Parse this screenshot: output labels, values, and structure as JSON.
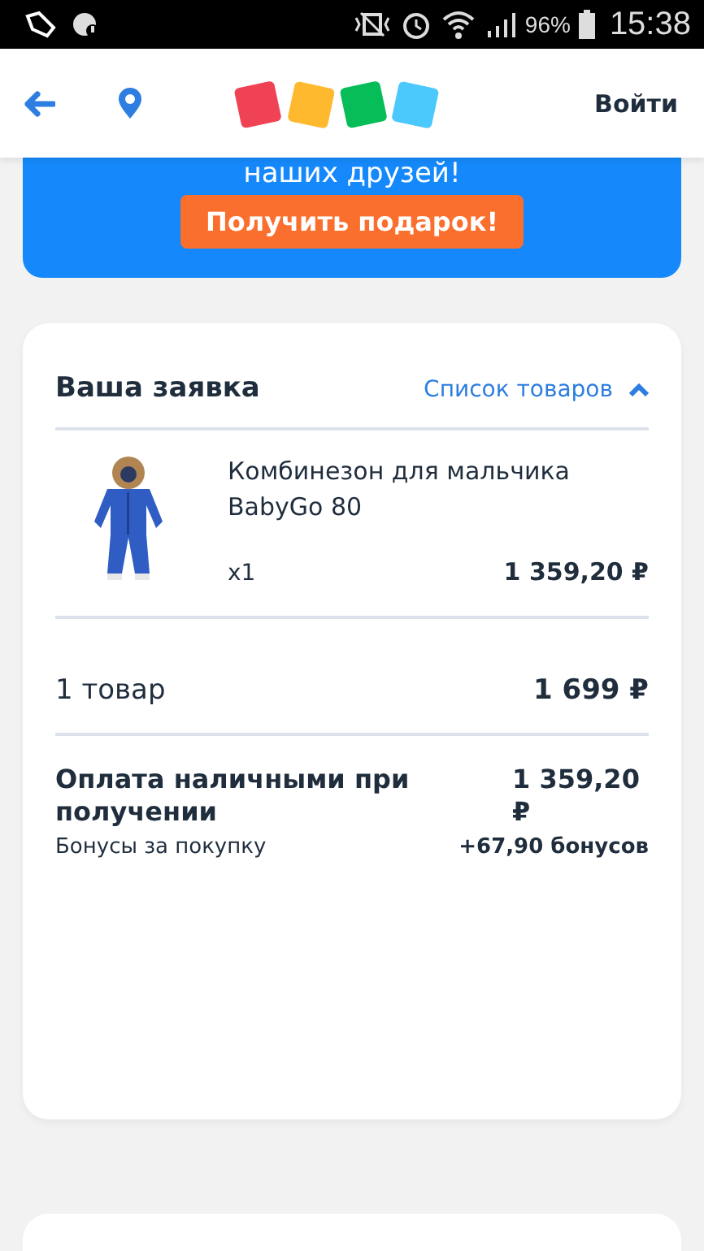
{
  "status_bar": {
    "battery_percent": "96%",
    "time": "15:38"
  },
  "header": {
    "login": "Войти"
  },
  "banner": {
    "text": "наших друзей!",
    "button": "Получить подарок!"
  },
  "order": {
    "title": "Ваша заявка",
    "list_link": "Список товаров",
    "expanded": true,
    "items": [
      {
        "name": "Комбинезон для мальчика BabyGo 80",
        "qty": "x1",
        "price": "1 359,20 ₽"
      }
    ],
    "count_label": "1 товар",
    "count_total": "1 699 ₽",
    "payment_label": "Оплата наличными при получении",
    "payment_total": "1 359,20 ₽",
    "bonus_label": "Бонусы за покупку",
    "bonus_value": "+67,90 бонусов"
  }
}
